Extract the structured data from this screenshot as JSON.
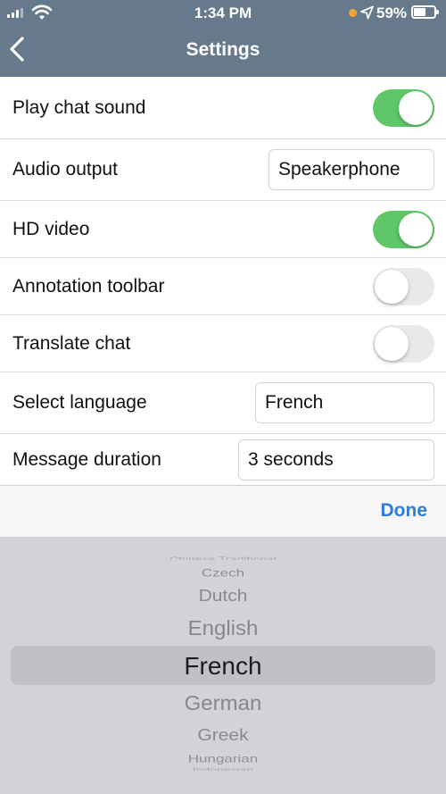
{
  "status_bar": {
    "time": "1:34 PM",
    "battery_percent": "59%",
    "battery_level": 0.59,
    "icons": [
      "signal-icon",
      "wifi-icon",
      "location-arrow-icon",
      "battery-icon"
    ]
  },
  "header": {
    "title": "Settings",
    "back_icon": "chevron-left-icon"
  },
  "settings": {
    "play_chat_sound": {
      "label": "Play chat sound",
      "on": true
    },
    "audio_output": {
      "label": "Audio output",
      "value": "Speakerphone"
    },
    "hd_video": {
      "label": "HD video",
      "on": true
    },
    "annotation_toolbar": {
      "label": "Annotation toolbar",
      "on": false
    },
    "translate_chat": {
      "label": "Translate chat",
      "on": false
    },
    "select_language": {
      "label": "Select language",
      "value": "French"
    },
    "message_duration": {
      "label": "Message duration",
      "value": "3 seconds"
    }
  },
  "picker": {
    "done_label": "Done",
    "options": [
      "Chinese Traditional",
      "Czech",
      "Dutch",
      "English",
      "French",
      "German",
      "Greek",
      "Hungarian",
      "Indonesian"
    ],
    "selected": "French"
  },
  "colors": {
    "header_bg": "#667a8b",
    "toggle_on": "#5fc768",
    "toggle_off": "#e9e9eb",
    "accent": "#2f7bd9",
    "status_dot": "#f2a33a"
  }
}
